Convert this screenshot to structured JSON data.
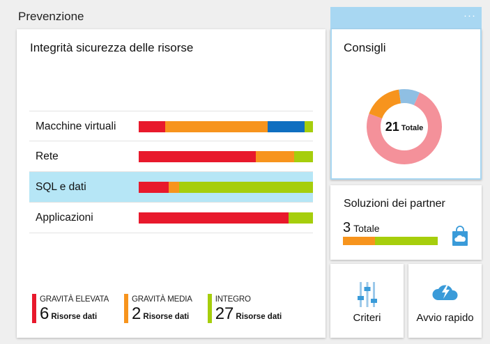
{
  "page": {
    "title": "Prevenzione"
  },
  "integrity": {
    "title": "Integrità sicurezza delle risorse",
    "rows": [
      {
        "label": "Macchine virtuali",
        "segments": [
          0.15,
          0.59,
          0.21,
          0.05
        ]
      },
      {
        "label": "Rete",
        "segments": [
          0.67,
          0.22,
          0.11
        ]
      },
      {
        "label": "SQL e dati",
        "segments": [
          0.17,
          0.06,
          0.77
        ]
      },
      {
        "label": "Applicazioni",
        "segments": [
          0.86,
          0.14
        ]
      }
    ],
    "legend": [
      {
        "label": "GRAVITÀ ELEVATA",
        "count": "6",
        "unit": "Risorse dati",
        "color": "#e8192c"
      },
      {
        "label": "GRAVITÀ MEDIA",
        "count": "2",
        "unit": "Risorse dati",
        "color": "#f7941d"
      },
      {
        "label": "INTEGRO",
        "count": "27",
        "unit": "Risorse dati",
        "color": "#a6ce0c"
      }
    ]
  },
  "colors": {
    "high": "#e8192c",
    "medium": "#f7941d",
    "low": "#0f6fc0",
    "healthy": "#a6ce0c",
    "accent": "#a8d7f2"
  },
  "recommendations": {
    "more_label": "···",
    "title": "Consigli",
    "total": "21",
    "total_label": "Totale",
    "slices": [
      {
        "fraction": 0.74,
        "color": "#f4919a"
      },
      {
        "fraction": 0.17,
        "color": "#f7941d"
      },
      {
        "fraction": 0.09,
        "color": "#8fbfe3"
      }
    ]
  },
  "partner": {
    "title": "Soluzioni dei partner",
    "total": "3",
    "total_label": "Totale",
    "segments": [
      0.34,
      0.66
    ],
    "icon": "shopping-bag-cloud-icon"
  },
  "tiles": {
    "criteri": {
      "label": "Criteri",
      "icon": "sliders-icon"
    },
    "avvio": {
      "label": "Avvio rapido",
      "icon": "cloud-lightning-icon"
    }
  }
}
